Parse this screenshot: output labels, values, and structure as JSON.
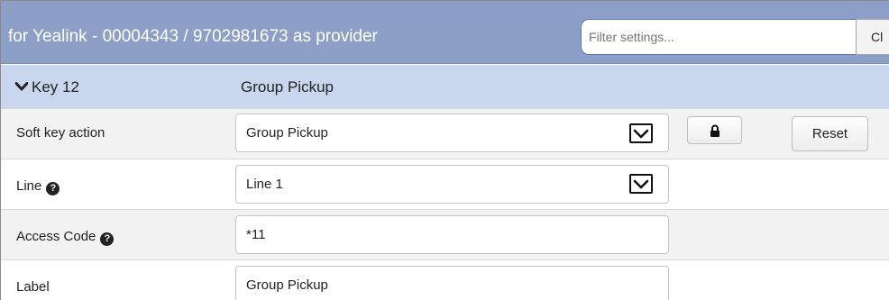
{
  "header": {
    "title": "for Yealink - 00004343 / 9702981673 as provider",
    "filter_placeholder": "Filter settings...",
    "clear_label": "Cl"
  },
  "key_section": {
    "key_label": "Key 12",
    "key_value": "Group Pickup"
  },
  "settings": {
    "soft_key_action": {
      "label": "Soft key action",
      "value": "Group Pickup"
    },
    "line": {
      "label": "Line",
      "value": "Line 1"
    },
    "access_code": {
      "label": "Access Code",
      "value": "*11"
    },
    "label": {
      "label": "Label",
      "value": "Group Pickup"
    }
  },
  "buttons": {
    "reset_label": "Reset",
    "help_glyph": "?"
  },
  "icons": {
    "key_toggle": "chevron-down-icon",
    "lock": "lock-icon",
    "help": "help-icon",
    "dropdown": "dropdown-arrow-icon"
  },
  "colors": {
    "header_bg": "#8d9fc6",
    "key_row_bg": "#cad6ee",
    "row_alt_bg": "#f2f2f2"
  }
}
